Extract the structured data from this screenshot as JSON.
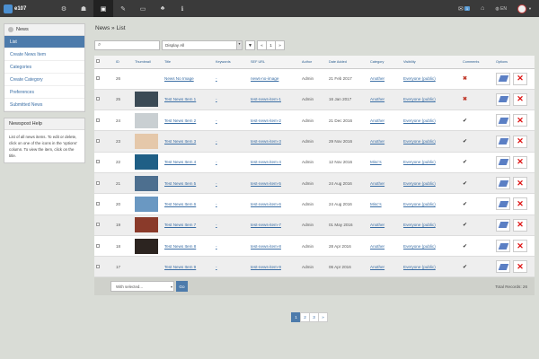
{
  "topbar": {
    "logo_text": "e107",
    "icons": [
      "settings-icon",
      "users-icon",
      "content-icon",
      "tools-icon",
      "display-icon",
      "plugins-icon",
      "about-icon"
    ],
    "mail_count": "1",
    "language": "EN"
  },
  "sidebar": {
    "title": "News",
    "items": [
      {
        "label": "List"
      },
      {
        "label": "Create News Item"
      },
      {
        "label": "Categories"
      },
      {
        "label": "Create Category"
      },
      {
        "label": "Preferences"
      },
      {
        "label": "Submitted News"
      }
    ]
  },
  "help": {
    "title": "Newspost Help",
    "text": "List of all news items. To edit or delete, click on one of the icons in the 'options' column. To view the item, click on the title."
  },
  "breadcrumb": "News » List",
  "toolbar": {
    "search_value": "",
    "filter_value": "Display All",
    "page_current": "1"
  },
  "table": {
    "columns": [
      "",
      "ID",
      "Thumbnail",
      "Title",
      "Keywords",
      "SEF URL",
      "Author",
      "Date Added",
      "Category",
      "Visibility",
      "Comments",
      "Options"
    ],
    "rows": [
      {
        "id": "26",
        "title": "News No Image",
        "keywords": "-",
        "sef": "news-no-image",
        "author": "Admin",
        "date": "21 Feb 2017",
        "category": "Another",
        "visibility": "Everyone (public)",
        "comments": "✖",
        "thumb": ""
      },
      {
        "id": "25",
        "title": "Test News Item 1",
        "keywords": "-",
        "sef": "test-news-item-1",
        "author": "Admin",
        "date": "16 Jan 2017",
        "category": "Another",
        "visibility": "Everyone (public)",
        "comments": "✖",
        "thumb": "#3b4a55"
      },
      {
        "id": "24",
        "title": "Test News Item 2",
        "keywords": "-",
        "sef": "test-news-item-2",
        "author": "Admin",
        "date": "21 Dec 2016",
        "category": "Another",
        "visibility": "Everyone (public)",
        "comments": "✔",
        "thumb": "#c9cfd2"
      },
      {
        "id": "23",
        "title": "Test News Item 3",
        "keywords": "-",
        "sef": "test-news-item-3",
        "author": "Admin",
        "date": "29 Nov 2016",
        "category": "Another",
        "visibility": "Everyone (public)",
        "comments": "✔",
        "thumb": "#e5c8aa"
      },
      {
        "id": "22",
        "title": "Test News Item 4",
        "keywords": "-",
        "sef": "test-news-item-4",
        "author": "Admin",
        "date": "12 Nov 2016",
        "category": "Misc's",
        "visibility": "Everyone (public)",
        "comments": "✔",
        "thumb": "#1f5f86"
      },
      {
        "id": "21",
        "title": "Test News Item 5",
        "keywords": "-",
        "sef": "test-news-item-5",
        "author": "Admin",
        "date": "24 Aug 2016",
        "category": "Another",
        "visibility": "Everyone (public)",
        "comments": "✔",
        "thumb": "#4d6f8f"
      },
      {
        "id": "20",
        "title": "Test News Item 6",
        "keywords": "-",
        "sef": "test-news-item-6",
        "author": "Admin",
        "date": "24 Aug 2016",
        "category": "Misc's",
        "visibility": "Everyone (public)",
        "comments": "✔",
        "thumb": "#6a98c2"
      },
      {
        "id": "19",
        "title": "Test News Item 7",
        "keywords": "-",
        "sef": "test-news-item-7",
        "author": "Admin",
        "date": "01 May 2016",
        "category": "Another",
        "visibility": "Everyone (public)",
        "comments": "✔",
        "thumb": "#8a3a2a"
      },
      {
        "id": "18",
        "title": "Test News Item 8",
        "keywords": "-",
        "sef": "test-news-item-8",
        "author": "Admin",
        "date": "28 Apr 2016",
        "category": "Another",
        "visibility": "Everyone (public)",
        "comments": "✔",
        "thumb": "#2c2420"
      },
      {
        "id": "17",
        "title": "Test News Item 9",
        "keywords": "-",
        "sef": "test-news-item-9",
        "author": "Admin",
        "date": "06 Apr 2016",
        "category": "Another",
        "visibility": "Everyone (public)",
        "comments": "✔",
        "thumb": ""
      }
    ]
  },
  "footer": {
    "with_selected": "With selected...",
    "go": "Go",
    "total": "Total Records: 26"
  },
  "pager": [
    "1",
    "2",
    "3",
    "»"
  ]
}
